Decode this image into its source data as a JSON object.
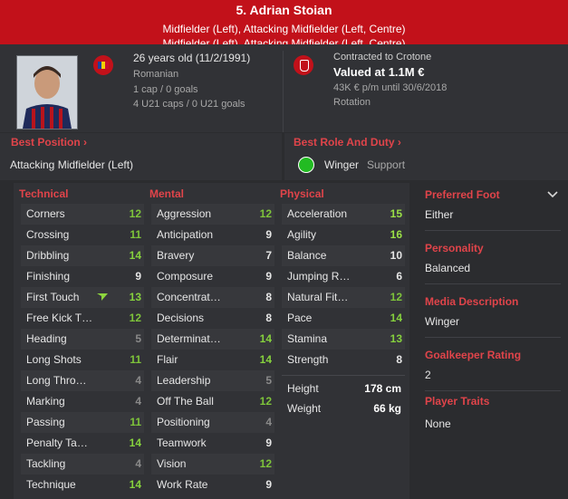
{
  "header": {
    "name": "5. Adrian Stoian",
    "positions": "Midfielder (Left), Attacking Midfielder (Left, Centre)",
    "positions_overflow": "Midfielder (Left), Attacking Midfielder (Left, Centre)"
  },
  "bio": {
    "age": "26 years old (11/2/1991)",
    "nationality": "Romanian",
    "caps": "1 cap / 0 goals",
    "u21": "4 U21 caps / 0 U21 goals"
  },
  "contract": {
    "contracted": "Contracted to Crotone",
    "value": "Valued at 1.1M €",
    "wage": "43K € p/m until 30/6/2018",
    "status": "Rotation"
  },
  "best_position": {
    "label": "Best Position ›",
    "value": "Attacking Midfielder (Left)"
  },
  "best_role": {
    "label": "Best Role And Duty ›",
    "role": "Winger",
    "duty": "Support"
  },
  "columns": {
    "technical": "Technical",
    "mental": "Mental",
    "physical": "Physical"
  },
  "technical": [
    {
      "name": "Corners",
      "value": "12"
    },
    {
      "name": "Crossing",
      "value": "11"
    },
    {
      "name": "Dribbling",
      "value": "14"
    },
    {
      "name": "Finishing",
      "value": "9"
    },
    {
      "name": "First Touch",
      "value": "13"
    },
    {
      "name": "Free Kick T…",
      "value": "12"
    },
    {
      "name": "Heading",
      "value": "5"
    },
    {
      "name": "Long Shots",
      "value": "11"
    },
    {
      "name": "Long Thro…",
      "value": "4"
    },
    {
      "name": "Marking",
      "value": "4"
    },
    {
      "name": "Passing",
      "value": "11"
    },
    {
      "name": "Penalty Ta…",
      "value": "14"
    },
    {
      "name": "Tackling",
      "value": "4"
    },
    {
      "name": "Technique",
      "value": "14"
    }
  ],
  "mental": [
    {
      "name": "Aggression",
      "value": "12"
    },
    {
      "name": "Anticipation",
      "value": "9"
    },
    {
      "name": "Bravery",
      "value": "7"
    },
    {
      "name": "Composure",
      "value": "9"
    },
    {
      "name": "Concentrat…",
      "value": "8"
    },
    {
      "name": "Decisions",
      "value": "8"
    },
    {
      "name": "Determinat…",
      "value": "14"
    },
    {
      "name": "Flair",
      "value": "14"
    },
    {
      "name": "Leadership",
      "value": "5"
    },
    {
      "name": "Off The Ball",
      "value": "12"
    },
    {
      "name": "Positioning",
      "value": "4"
    },
    {
      "name": "Teamwork",
      "value": "9"
    },
    {
      "name": "Vision",
      "value": "12"
    },
    {
      "name": "Work Rate",
      "value": "9"
    }
  ],
  "physical": [
    {
      "name": "Acceleration",
      "value": "15"
    },
    {
      "name": "Agility",
      "value": "16"
    },
    {
      "name": "Balance",
      "value": "10"
    },
    {
      "name": "Jumping R…",
      "value": "6"
    },
    {
      "name": "Natural Fit…",
      "value": "12"
    },
    {
      "name": "Pace",
      "value": "14"
    },
    {
      "name": "Stamina",
      "value": "13"
    },
    {
      "name": "Strength",
      "value": "8"
    }
  ],
  "height": {
    "label": "Height",
    "value": "178 cm"
  },
  "weight": {
    "label": "Weight",
    "value": "66 kg"
  },
  "side": {
    "foot_label": "Preferred Foot",
    "foot_value": "Either",
    "personality_label": "Personality",
    "personality_value": "Balanced",
    "media_label": "Media Description",
    "media_value": "Winger",
    "gk_label": "Goalkeeper Rating",
    "gk_value": "2",
    "traits_label": "Player Traits",
    "traits_value": "None"
  },
  "colors": {
    "header": "#c2111a",
    "grey": "#8a8a8a",
    "green_dim": "#7ec43a",
    "green_mid": "#86d13d",
    "green_bright": "#9ae046",
    "white": "#e6e6e6"
  },
  "icons": {
    "flag": "romania-flag-icon",
    "club": "club-crest-icon",
    "improve": "arrow-up-icon",
    "role": "role-rating-dot-icon",
    "chevron": "chevron-down-icon"
  }
}
